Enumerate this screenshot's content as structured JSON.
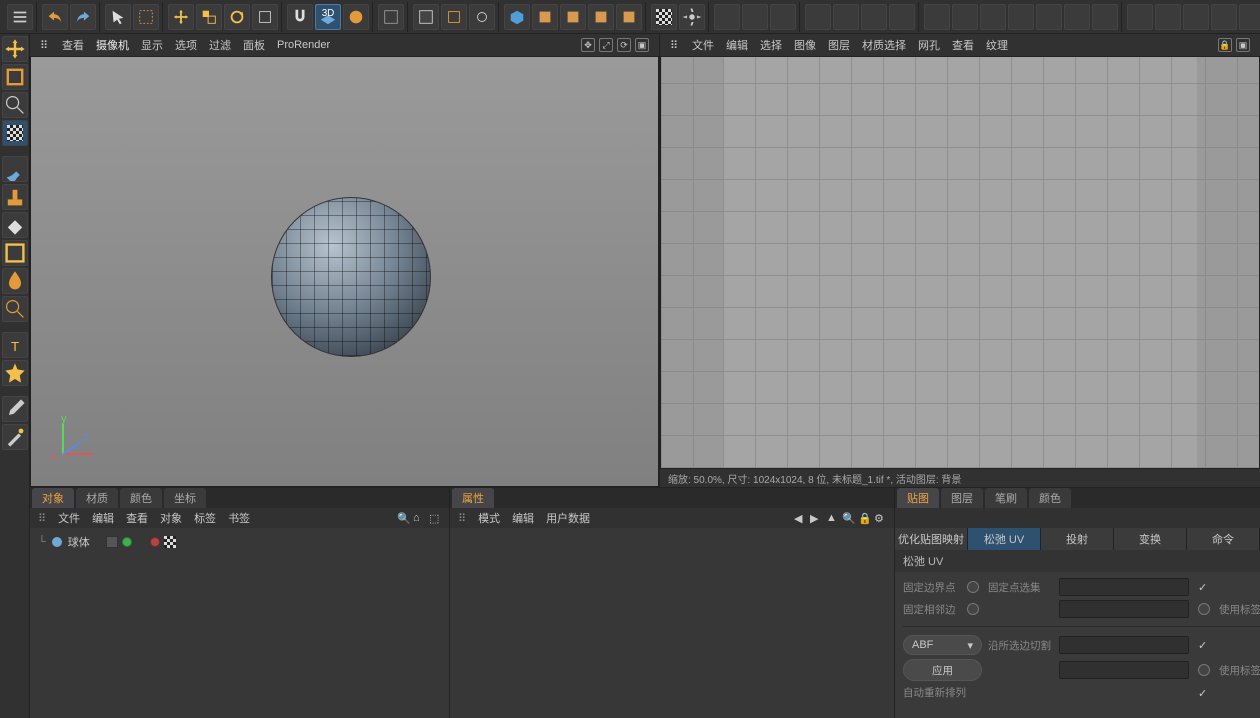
{
  "view_menu": {
    "view": "查看",
    "camera": "摄像机",
    "display": "显示",
    "options": "选项",
    "filter": "过滤",
    "panel": "面板",
    "prorender": "ProRender"
  },
  "uv_menu": {
    "file": "文件",
    "edit": "编辑",
    "select": "选择",
    "image": "图像",
    "layer": "图层",
    "matselect": "材质选择",
    "mesh": "网孔",
    "view": "查看",
    "texture": "纹理"
  },
  "uv_status": "缩放: 50.0%, 尺寸: 1024x1024, 8 位, 未标题_1.tif *, 活动图层: 背景",
  "obj_tabs": {
    "objects": "对象",
    "materials": "材质",
    "colors": "颜色",
    "coords": "坐标"
  },
  "obj_menu": {
    "file": "文件",
    "edit": "编辑",
    "view": "查看",
    "objects": "对象",
    "tags": "标签",
    "bookmarks": "书签"
  },
  "object_item": {
    "name": "球体"
  },
  "attr_tabs": {
    "attributes": "属性"
  },
  "attr_menu": {
    "mode": "模式",
    "edit": "编辑",
    "userdata": "用户数据"
  },
  "uvpanel_tabs": {
    "texture": "贴图",
    "layers": "图层",
    "brush": "笔刷",
    "colors": "颜色"
  },
  "uv_subtabs": {
    "optimize": "优化贴图映射",
    "relax": "松弛 UV",
    "projection": "投射",
    "transform": "变换",
    "command": "命令"
  },
  "relax_section": {
    "title": "松弛 UV"
  },
  "relax_form": {
    "fix_boundary_points": "固定边界点",
    "fix_point_selection": "固定点选集",
    "fix_neighbor_edges": "固定相邻边",
    "use_tag": "使用标签",
    "algorithm": "ABF",
    "cut_along_selected_edges": "沿所选边切割",
    "apply": "应用",
    "auto_rearrange": "自动重新排列"
  }
}
